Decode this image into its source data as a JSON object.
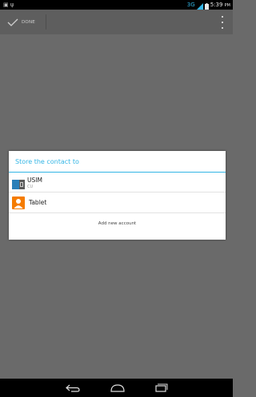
{
  "status_bar": {
    "network": "3G",
    "time": "5:39",
    "ampm": "PM",
    "left_icons": [
      "image-icon",
      "usb-icon"
    ]
  },
  "action_bar": {
    "done_label": "DONE"
  },
  "dialog": {
    "title": "Store the contact to",
    "accounts": [
      {
        "name": "USIM",
        "subtitle": "CU",
        "icon": "sim-card-icon"
      },
      {
        "name": "Tablet",
        "icon": "contact-person-icon"
      }
    ],
    "add_new_label": "Add new account"
  },
  "colors": {
    "accent": "#33b5e5",
    "tablet_icon": "#f57c00",
    "scrim": "#6a6a6a",
    "status_bar": "#000000"
  }
}
